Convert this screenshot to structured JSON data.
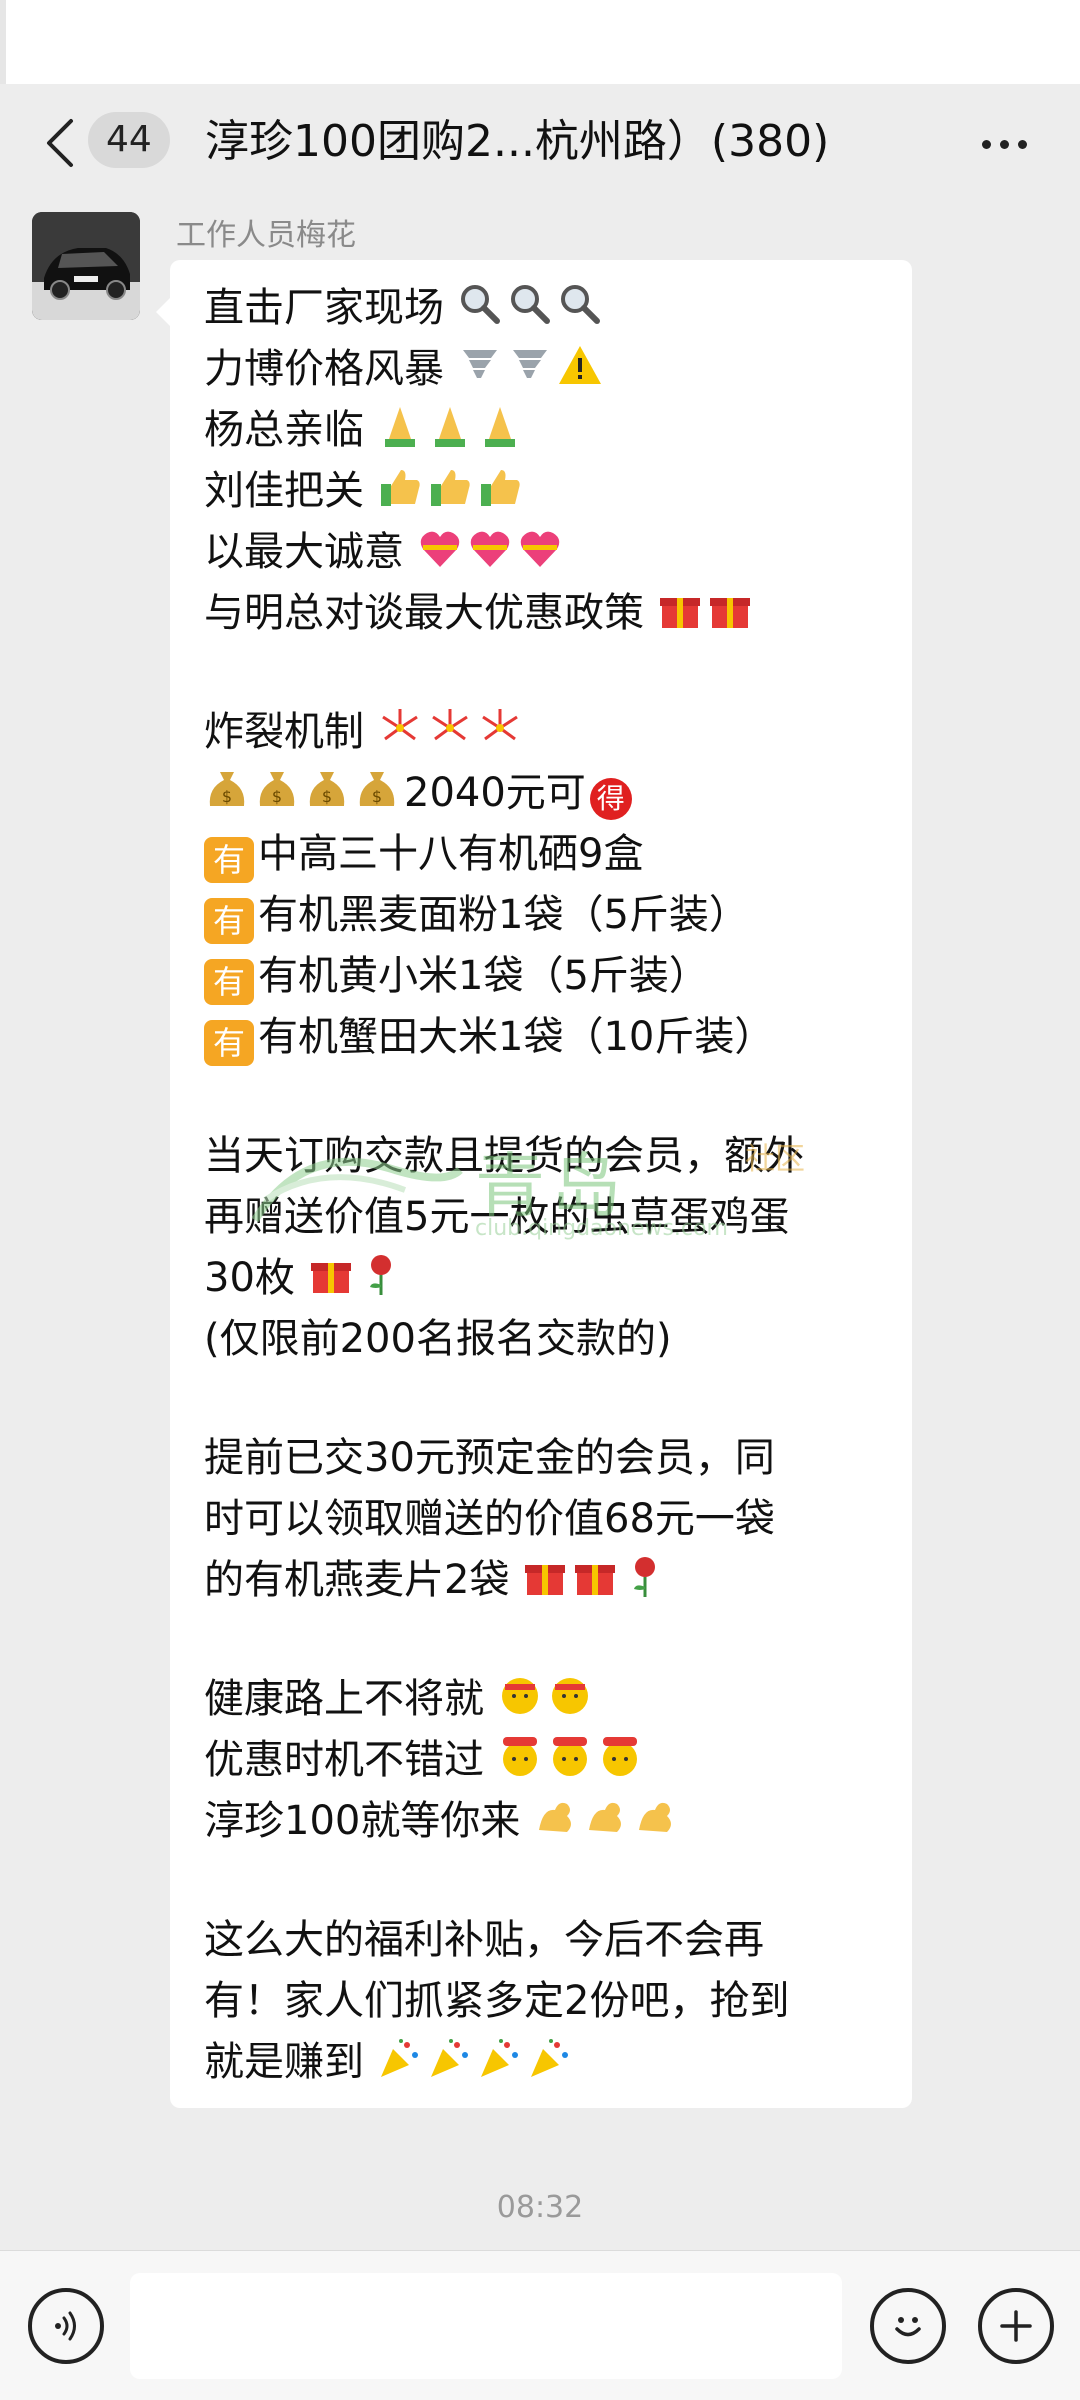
{
  "header": {
    "back_label": "",
    "unread_count": "44",
    "title": "淳珍100团购2...杭州路）(380)"
  },
  "message": {
    "sender": "工作人员梅花",
    "lines": [
      "直击厂家现场",
      "力博价格风暴",
      "杨总亲临",
      "刘佳把关",
      "以最大诚意",
      "与明总对谈最大优惠政策",
      "炸裂机制",
      "2040元可",
      "得",
      "有",
      "中高三十八有机硒9盒",
      "有机黑麦面粉1袋（5斤装）",
      "有机黄小米1袋（5斤装）",
      "有机蟹田大米1袋（10斤装）",
      "当天订购交款且提货的会员，额外",
      "再赠送价值5元一枚的虫草蛋鸡蛋",
      "30枚",
      "(仅限前200名报名交款的)",
      "提前已交30元预定金的会员，同",
      "时可以领取赠送的价值68元一袋",
      "的有机燕麦片2袋",
      "健康路上不将就",
      "优惠时机不错过",
      "淳珍100就等你来",
      "这么大的福利补贴，今后不会再",
      "有！家人们抓紧多定2份吧，抢到",
      "就是赚到"
    ],
    "emoji_names": [
      "magnifier-icon",
      "tornado-icon",
      "warning-icon",
      "pray-icon",
      "thumbs-up-icon",
      "heart-gift-icon",
      "gift-icon",
      "firework-icon",
      "money-bag-icon",
      "rose-icon",
      "salute-icon",
      "666-icon",
      "muscle-icon",
      "party-popper-icon"
    ]
  },
  "watermark": {
    "text": "青岛",
    "tag": "社区",
    "sub": "club.qingdaonews.com"
  },
  "timestamp": "08:32",
  "input": {
    "placeholder": ""
  },
  "colors": {
    "background": "#ededed",
    "bubble": "#ffffff",
    "badge_orange": "#f5a623",
    "badge_red": "#e02020"
  }
}
